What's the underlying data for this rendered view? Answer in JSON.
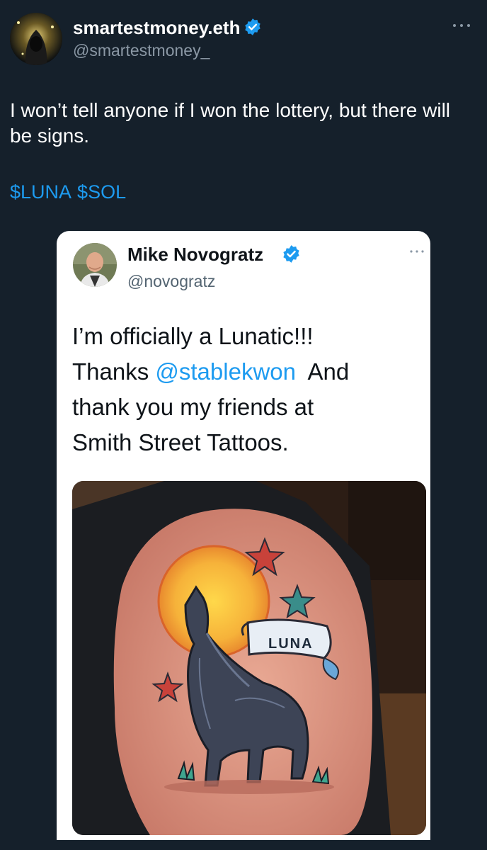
{
  "outer_tweet": {
    "display_name": "smartestmoney.eth",
    "handle": "@smartestmoney_",
    "text": "I won’t tell anyone if I won the lottery, but there will be signs.",
    "cashtags": [
      "$LUNA",
      "$SOL"
    ],
    "verified_icon": "verified-badge-icon",
    "more_icon": "more-options-icon"
  },
  "quoted_tweet": {
    "display_name": "Mike Novogratz",
    "handle": "@novogratz",
    "text_line1": "I’m officially a Lunatic!!!",
    "text_thanks": "Thanks ",
    "mention": "@stablekwon",
    "text_after_mention": "  And",
    "text_line3": "thank you my friends at",
    "text_line4": "Smith Street Tattoos.",
    "photo": {
      "banner_text": "LUNA"
    }
  },
  "colors": {
    "background": "#15202b",
    "accent": "#1d9bf0",
    "secondary_text": "#8b98a5"
  }
}
